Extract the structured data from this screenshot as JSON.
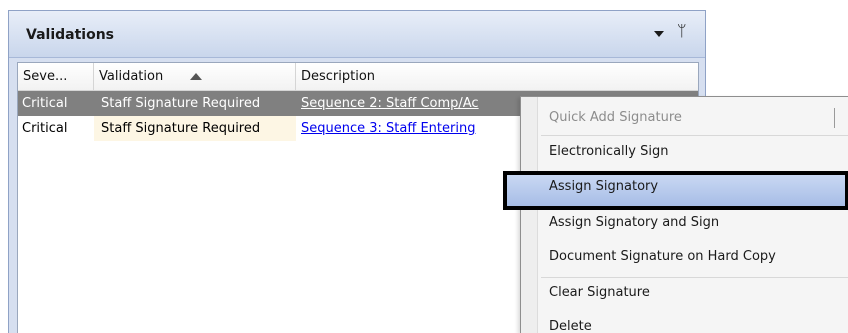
{
  "panel": {
    "title": "Validations"
  },
  "grid": {
    "columns": [
      "Seve...",
      "Validation",
      "Description"
    ],
    "sort": {
      "column": "Validation",
      "direction": "ascending"
    },
    "rows": [
      {
        "severity": "Critical",
        "validation": "Staff Signature Required",
        "description": "Sequence 2: Staff Comp/Ac",
        "selected": true
      },
      {
        "severity": "Critical",
        "validation": "Staff Signature Required",
        "description": "Sequence 3: Staff Entering",
        "selected": false
      }
    ]
  },
  "context_menu": {
    "items": [
      {
        "label": "Quick Add Signature",
        "enabled": false
      },
      {
        "label": "Electronically Sign",
        "enabled": true
      },
      {
        "label": "Assign Signatory",
        "enabled": true,
        "highlighted": true
      },
      {
        "label": "Assign Signatory and Sign",
        "enabled": true
      },
      {
        "label": "Document Signature on Hard Copy",
        "enabled": true
      },
      {
        "label": "Clear Signature",
        "enabled": true
      },
      {
        "label": "Delete",
        "enabled": true
      }
    ]
  },
  "icons": {
    "panel_dropdown": "chevron-down-icon",
    "panel_pin": "pin-icon",
    "sort": "sort-ascending-icon"
  },
  "colors": {
    "selected_row": "#808080",
    "link": "#0000ee",
    "menu_highlight": "#b8cbee",
    "highlight_border": "#000000"
  }
}
